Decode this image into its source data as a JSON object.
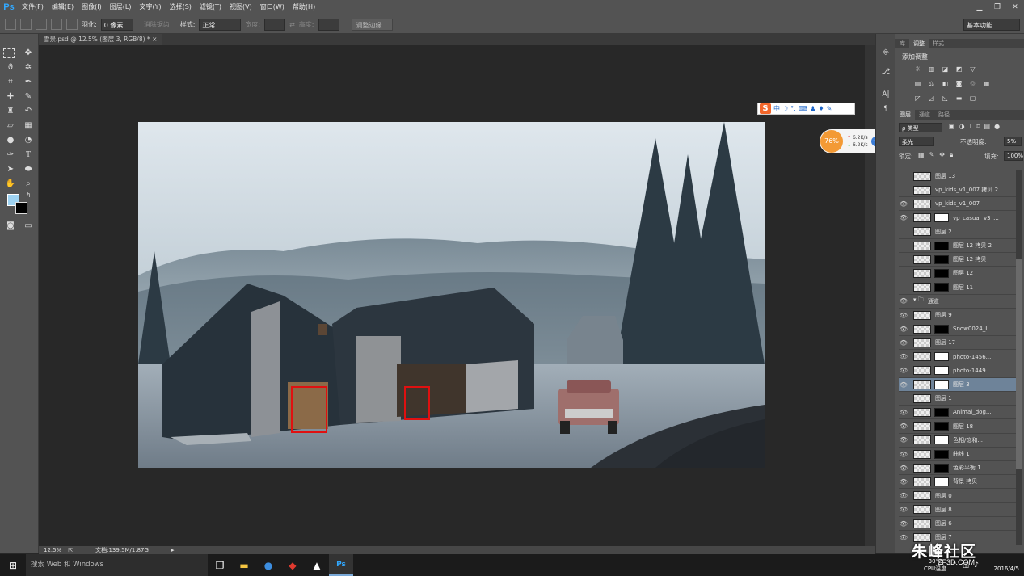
{
  "app": {
    "logo": "Ps"
  },
  "menu": [
    "文件(F)",
    "编辑(E)",
    "图像(I)",
    "图层(L)",
    "文字(Y)",
    "选择(S)",
    "滤镜(T)",
    "视图(V)",
    "窗口(W)",
    "帮助(H)"
  ],
  "options": {
    "feather_label": "羽化:",
    "feather_value": "0 像素",
    "antialias_label": "消除锯齿",
    "style_label": "样式:",
    "style_value": "正常",
    "width_label": "宽度:",
    "height_label": "高度:",
    "refine_button": "调整边缘...",
    "workspace": "基本功能"
  },
  "document": {
    "tab_title": "雪景.psd @ 12.5% (图层 3, RGB/8) *"
  },
  "status": {
    "zoom": "12.5%",
    "doc_info": "文档:139.5M/1.87G"
  },
  "ime": {
    "cn": "中"
  },
  "net_widget": {
    "percent": "76%",
    "up": "6.2K/s",
    "down": "6.2K/s"
  },
  "panels": {
    "top_tabs": [
      "库",
      "调整",
      "样式"
    ],
    "adjust_title": "添加调整",
    "layer_tabs": [
      "图层",
      "通道",
      "路径"
    ],
    "filter_kind": "ρ 类型",
    "blend_mode": "柔光",
    "opacity_label": "不透明度:",
    "opacity_value": "5%",
    "lock_label": "锁定:",
    "fill_label": "填充:",
    "fill_value": "100%"
  },
  "layers": [
    {
      "name": "图层 13",
      "visible": false,
      "mask": ""
    },
    {
      "name": "vp_kids_v1_007 拷贝 2",
      "visible": false,
      "mask": ""
    },
    {
      "name": "vp_kids_v1_007",
      "visible": true,
      "mask": ""
    },
    {
      "name": "vp_casual_v3_...",
      "visible": true,
      "mask": "white"
    },
    {
      "name": "图层 2",
      "visible": false,
      "mask": ""
    },
    {
      "name": "图层 12 拷贝 2",
      "visible": false,
      "mask": "black"
    },
    {
      "name": "图层 12 拷贝",
      "visible": false,
      "mask": "black"
    },
    {
      "name": "图层 12",
      "visible": false,
      "mask": "black"
    },
    {
      "name": "图层 11",
      "visible": false,
      "mask": "black"
    },
    {
      "name": "通道",
      "visible": true,
      "mask": "group"
    },
    {
      "name": "图层 9",
      "visible": true,
      "mask": ""
    },
    {
      "name": "Snow0024_L",
      "visible": true,
      "mask": "black"
    },
    {
      "name": "图层 17",
      "visible": true,
      "mask": ""
    },
    {
      "name": "photo-1456...",
      "visible": true,
      "mask": "white"
    },
    {
      "name": "photo-1449...",
      "visible": true,
      "mask": "white"
    },
    {
      "name": "图层 3",
      "visible": true,
      "mask": "white",
      "selected": true
    },
    {
      "name": "图层 1",
      "visible": false,
      "mask": ""
    },
    {
      "name": "Animal_dog...",
      "visible": true,
      "mask": "black"
    },
    {
      "name": "图层 18",
      "visible": true,
      "mask": "black"
    },
    {
      "name": "色相/饱和...",
      "visible": true,
      "mask": "white"
    },
    {
      "name": "曲线 1",
      "visible": true,
      "mask": "black"
    },
    {
      "name": "色彩平衡 1",
      "visible": true,
      "mask": "black"
    },
    {
      "name": "背景 拷贝",
      "visible": true,
      "mask": "white"
    },
    {
      "name": "图层 0",
      "visible": true,
      "mask": ""
    },
    {
      "name": "图层 8",
      "visible": true,
      "mask": ""
    },
    {
      "name": "图层 6",
      "visible": true,
      "mask": ""
    },
    {
      "name": "图层 7",
      "visible": true,
      "mask": ""
    }
  ],
  "taskbar": {
    "search_placeholder": "搜索 Web 和 Windows",
    "temp": "30℃",
    "temp_label": "CPU温度",
    "date": "2016/4/5"
  },
  "watermark": {
    "main": "朱峰社区",
    "sub": "ZF3D.COM"
  },
  "colors": {
    "accent": "#31a8ff",
    "fg_swatch": "#9ed3f2",
    "selection_red": "#e01010"
  }
}
